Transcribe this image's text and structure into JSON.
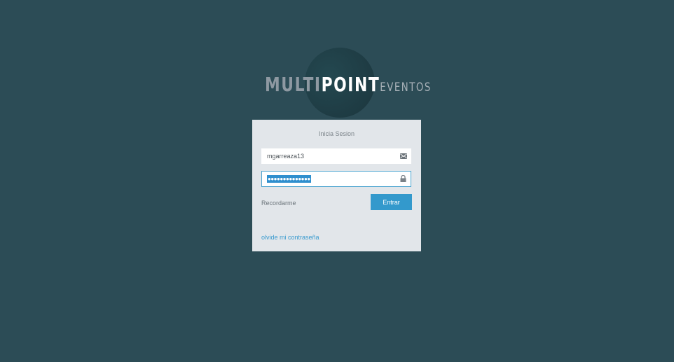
{
  "logo": {
    "part1": "MULTI",
    "part2": "POINT",
    "part3": "EVENTOS"
  },
  "login": {
    "title": "Inicia Sesion",
    "username_value": "mgarreaza13",
    "password_mask": "●●●●●●●●●●●●●●",
    "remember_label": "Recordarme",
    "submit_label": "Entrar",
    "forgot_label": "olvide mi contraseña",
    "username_icon": "envelope-icon",
    "password_icon": "lock-icon"
  },
  "colors": {
    "background": "#2c4c56",
    "card": "#e2e6ea",
    "accent": "#3399cc",
    "selection": "#2f8fce"
  }
}
